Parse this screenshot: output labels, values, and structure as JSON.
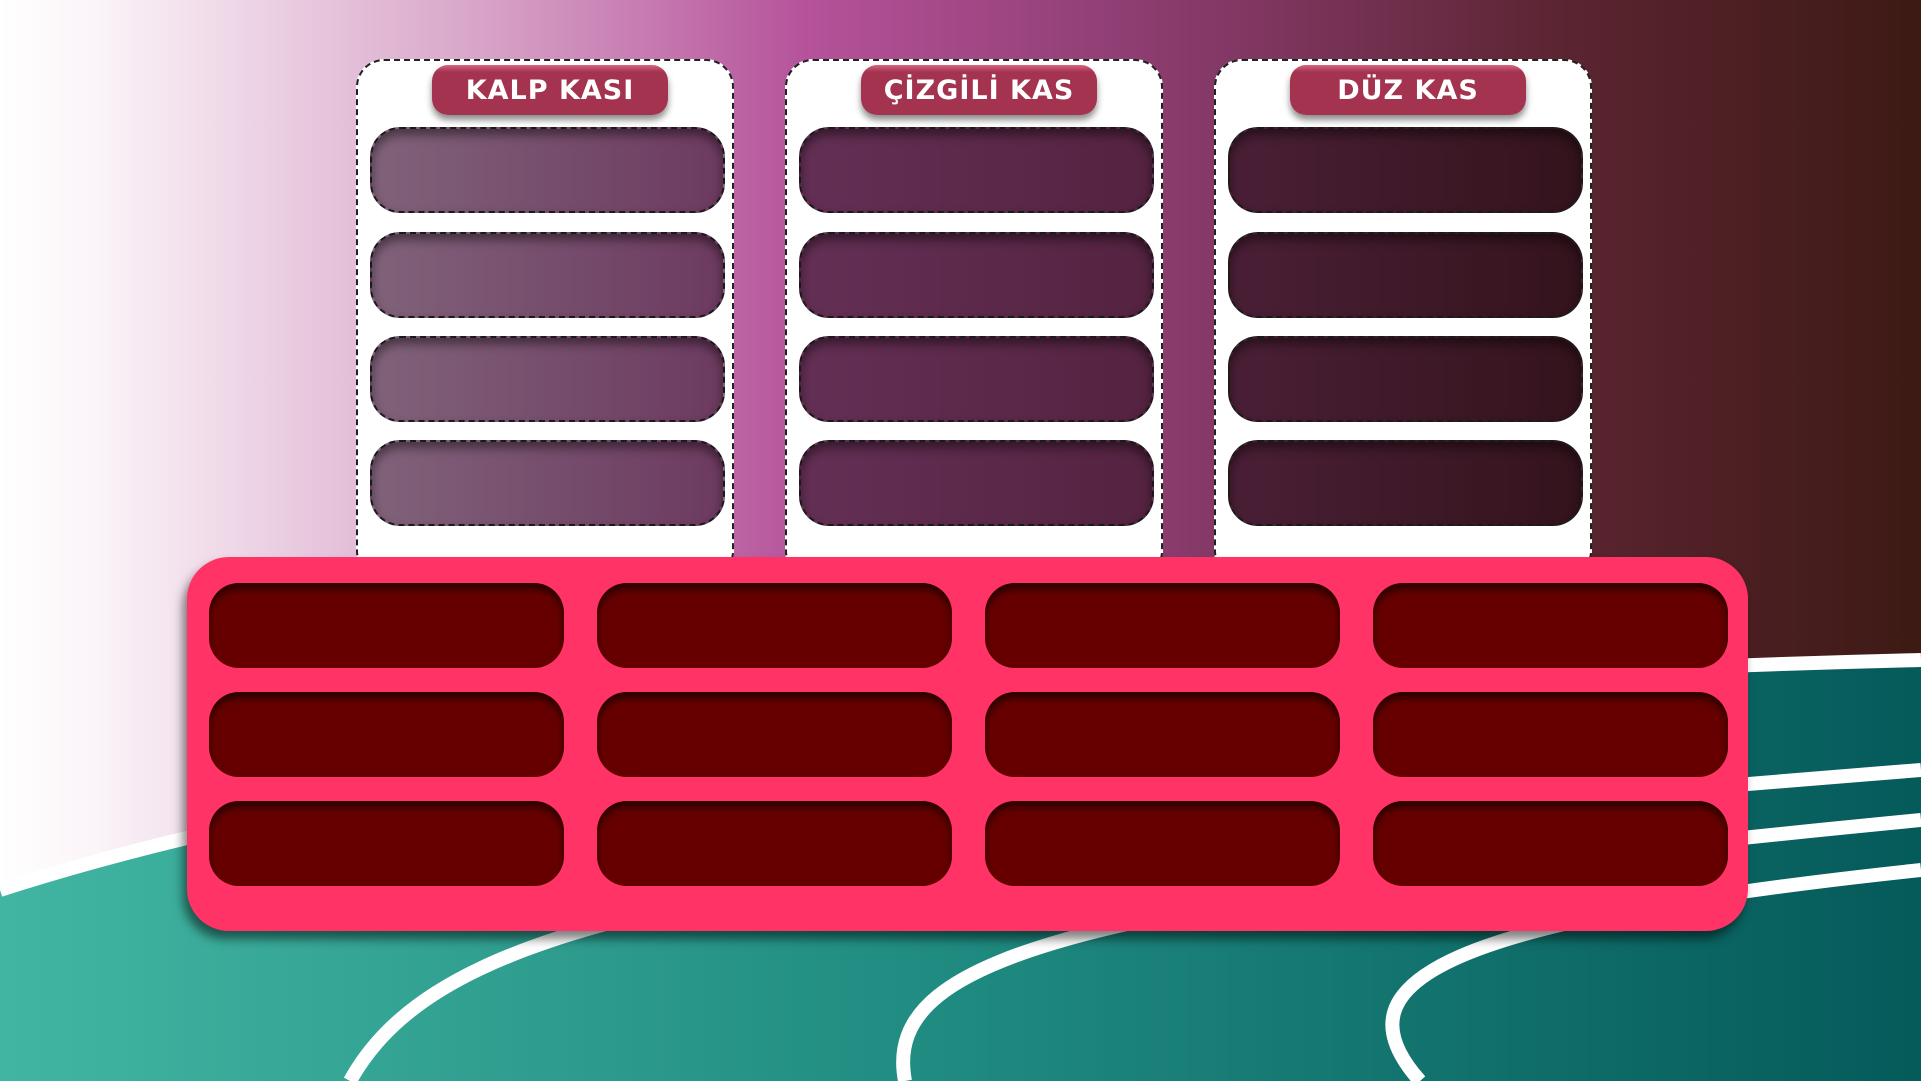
{
  "categories": [
    {
      "title": "KALP KASI",
      "slots": 4,
      "slot_colors": [
        "#80627a",
        "#6d3a60"
      ]
    },
    {
      "title": "ÇİZGİLİ KAS",
      "slots": 4,
      "slot_colors": [
        "#642f55",
        "#542340"
      ]
    },
    {
      "title": "DÜZ KAS",
      "slots": 4,
      "slot_colors": [
        "#4a1f36",
        "#34131c"
      ]
    }
  ],
  "answer_bank": {
    "rows": 3,
    "columns": 4,
    "card_color": "#660000",
    "panel_color": "#ff3366"
  },
  "colors": {
    "header_pill": "#a3334f",
    "teal": "#2a9a8a",
    "bg_pink": "#b5529a",
    "bg_brown": "#3d1a14"
  }
}
